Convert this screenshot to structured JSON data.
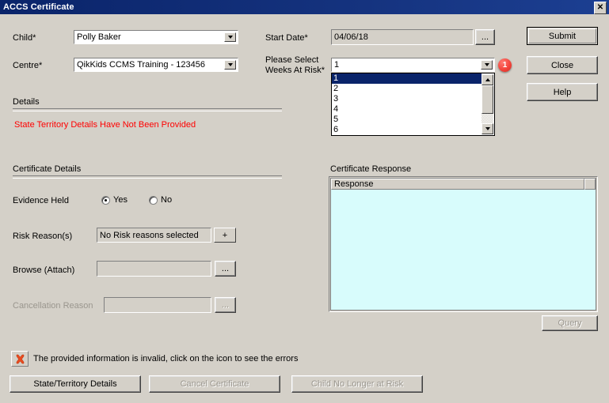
{
  "window": {
    "title": "ACCS Certificate",
    "close_glyph": "✕"
  },
  "form": {
    "child_label": "Child*",
    "child_value": "Polly Baker",
    "centre_label": "Centre*",
    "centre_value": "QikKids CCMS Training - 123456",
    "start_date_label": "Start Date*",
    "start_date_value": "04/06/18",
    "start_date_browse": "...",
    "weeks_label_line1": "Please Select",
    "weeks_label_line2": "Weeks At Risk*",
    "weeks_value": "1",
    "weeks_badge": "1",
    "weeks_options": [
      "1",
      "2",
      "3",
      "4",
      "5",
      "6"
    ],
    "weeks_selected_index": 0
  },
  "details": {
    "heading": "Details",
    "message": "State Territory Details Have Not Been Provided"
  },
  "certificate_details": {
    "heading": "Certificate Details",
    "evidence_held_label": "Evidence Held",
    "evidence_yes": "Yes",
    "evidence_no": "No",
    "evidence_selected": "Yes",
    "risk_reason_label": "Risk Reason(s)",
    "risk_reason_value": "No Risk reasons selected",
    "risk_add_label": "+",
    "browse_label": "Browse (Attach)",
    "browse_value": "",
    "browse_btn": "...",
    "cancellation_label": "Cancellation Reason",
    "cancellation_value": "",
    "cancellation_btn": "..."
  },
  "certificate_response": {
    "heading": "Certificate Response",
    "column_header": "Response",
    "rows": [],
    "query_label": "Query"
  },
  "actions": {
    "submit": "Submit",
    "close": "Close",
    "help": "Help",
    "state_territory_details": "State/Territory Details",
    "cancel_certificate": "Cancel Certificate",
    "child_no_longer_at_risk": "Child No Longer at Risk"
  },
  "status": {
    "error_message": "The provided information is invalid, click on the icon to see the errors",
    "error_icon": "error-cross-icon"
  },
  "colors": {
    "window_bg": "#d4d0c8",
    "titlebar": "#0a246a",
    "error_text": "#ff0000",
    "badge": "#f4453c",
    "grid_body": "#d8fcfc",
    "selection": "#0a246a"
  }
}
